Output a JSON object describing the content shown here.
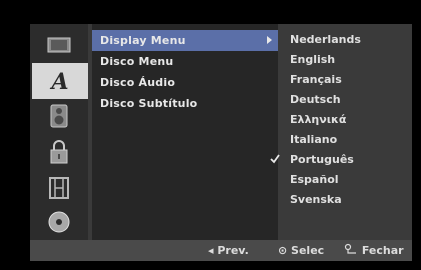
{
  "menu": {
    "items": [
      {
        "label": "Display Menu",
        "selected": true
      },
      {
        "label": "Disco Menu",
        "selected": false
      },
      {
        "label": "Disco Áudio",
        "selected": false
      },
      {
        "label": "Disco Subtítulo",
        "selected": false
      }
    ]
  },
  "languages": {
    "options": [
      {
        "label": "Nederlands",
        "checked": false
      },
      {
        "label": "English",
        "checked": false
      },
      {
        "label": "Français",
        "checked": false
      },
      {
        "label": "Deutsch",
        "checked": false
      },
      {
        "label": "Ελληνικά",
        "checked": false
      },
      {
        "label": "Italiano",
        "checked": false
      },
      {
        "label": "Português",
        "checked": true
      },
      {
        "label": "Español",
        "checked": false
      },
      {
        "label": "Svenska",
        "checked": false
      }
    ]
  },
  "sidebar": {
    "icons": [
      "display-icon",
      "language-icon",
      "audio-icon",
      "lock-icon",
      "film-icon",
      "disc-icon"
    ],
    "active_index": 1
  },
  "footer": {
    "prev_label": "◂ Prev.",
    "select_label": "⊙ Selec",
    "close_label": "Fechar"
  },
  "colors": {
    "highlight": "#5b6fa8",
    "panel": "#3a3a3a"
  }
}
